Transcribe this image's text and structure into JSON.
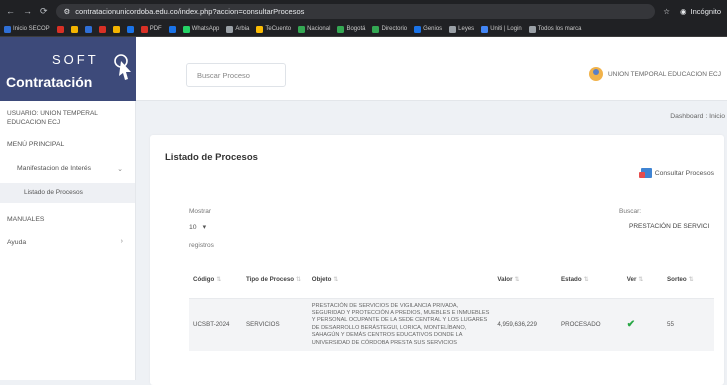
{
  "browser": {
    "url": "contratacionunicordoba.edu.co/index.php?accion=consultarProcesos",
    "incognito_label": "Incógnito",
    "bookmarks": [
      {
        "label": "Inicio SECOP",
        "color": "#2f6fd6"
      },
      {
        "label": "",
        "color": "#d93025"
      },
      {
        "label": "",
        "color": "#f4b400"
      },
      {
        "label": "",
        "color": "#2f6fd6"
      },
      {
        "label": "",
        "color": "#d93025"
      },
      {
        "label": "",
        "color": "#f4b400"
      },
      {
        "label": "",
        "color": "#1a73e8"
      },
      {
        "label": "PDF",
        "color": "#d93025"
      },
      {
        "label": "",
        "color": "#1a73e8"
      },
      {
        "label": "WhatsApp",
        "color": "#25d366"
      },
      {
        "label": "Arbia",
        "color": "#9aa0a6"
      },
      {
        "label": "TeCuento",
        "color": "#fbbc04"
      },
      {
        "label": "Nacional",
        "color": "#34a853"
      },
      {
        "label": "Bogotá",
        "color": "#34a853"
      },
      {
        "label": "Directorio",
        "color": "#34a853"
      },
      {
        "label": "Genios",
        "color": "#1a73e8"
      },
      {
        "label": "Leyes",
        "color": "#9aa0a6"
      },
      {
        "label": "Uniti | Login",
        "color": "#4285f4"
      },
      {
        "label": "Todos los marca",
        "color": "#9aa0a6"
      }
    ]
  },
  "brand": {
    "soft": "SOFT",
    "contratacion": "Contratación"
  },
  "header": {
    "search_placeholder": "Buscar Proceso",
    "user_name": "UNION TEMPORAL EDUCACION ECJ"
  },
  "sidebar": {
    "user_label": "USUARIO: UNION TEMPERAL EDUCACION ECJ",
    "menu_principal": "MENÚ PRINCIPAL",
    "manifestacion": "Manifestacion de Interés",
    "listado": "Listado de Procesos",
    "manuales": "MANUALES",
    "ayuda": "Ayuda"
  },
  "breadcrumb": "Dashboard : Inicio",
  "card": {
    "title": "Listado de Procesos",
    "consult_label": "Consultar Procesos",
    "mostrar_label": "Mostrar",
    "mostrar_value": "10",
    "registros_label": "registros",
    "buscar_label": "Buscar:",
    "buscar_value": "PRESTACIÓN DE SERVICI"
  },
  "table": {
    "headers": [
      "Código",
      "Tipo de Proceso",
      "Objeto",
      "Valor",
      "Estado",
      "Ver",
      "Sorteo"
    ],
    "rows": [
      {
        "codigo": "UCSBT-2024",
        "tipo": "SERVICIOS",
        "objeto": "PRESTACIÓN DE SERVICIOS DE VIGILANCIA PRIVADA, SEGURIDAD Y PROTECCIÓN A PREDIOS, MUEBLES E INMUEBLES Y PERSONAL OCUPANTE DE LA SEDE CENTRAL Y LOS LUGARES DE DESARROLLO BERÁSTEGUI, LORICA, MONTELÍBANO, SAHAGÚN Y DEMÁS CENTROS EDUCATIVOS DONDE LA UNIVERSIDAD DE CÓRDOBA PRESTA SUS SERVICIOS",
        "valor": "4,959,636,229",
        "estado": "PROCESADO",
        "ver": "✔",
        "sorteo": "55"
      }
    ]
  }
}
